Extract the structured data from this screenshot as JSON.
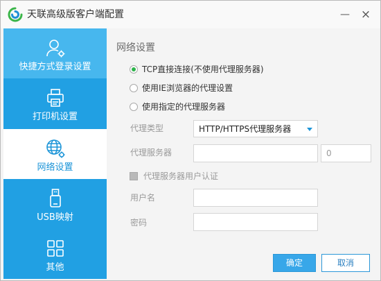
{
  "window": {
    "title": "天联高级版客户端配置",
    "minimize_glyph": "—",
    "close_glyph": "×"
  },
  "sidebar": {
    "items": [
      {
        "label": "快捷方式登录设置",
        "icon": "user-gear-icon",
        "selected": false,
        "highlighted": true
      },
      {
        "label": "打印机设置",
        "icon": "printer-icon",
        "selected": false,
        "highlighted": false
      },
      {
        "label": "网络设置",
        "icon": "globe-gear-icon",
        "selected": true,
        "highlighted": false
      },
      {
        "label": "USB映射",
        "icon": "usb-icon",
        "selected": false,
        "highlighted": false
      },
      {
        "label": "其他",
        "icon": "grid-icon",
        "selected": false,
        "highlighted": false
      }
    ]
  },
  "network": {
    "heading": "网络设置",
    "connection_options": [
      {
        "label": "TCP直接连接(不使用代理服务器)",
        "checked": true
      },
      {
        "label": "使用IE浏览器的代理设置",
        "checked": false
      },
      {
        "label": "使用指定的代理服务器",
        "checked": false
      }
    ],
    "proxy_type": {
      "label": "代理类型",
      "value": "HTTP/HTTPS代理服务器"
    },
    "proxy_server": {
      "label": "代理服务器",
      "value": "",
      "port": "0"
    },
    "auth": {
      "label": "代理服务器用户认证",
      "checked": false
    },
    "username": {
      "label": "用户名",
      "value": ""
    },
    "password": {
      "label": "密码",
      "value": ""
    }
  },
  "buttons": {
    "ok": "确定",
    "cancel": "取消"
  },
  "colors": {
    "sidebar": "#21a0e3",
    "sidebar_hover": "#47b7ee",
    "accent": "#1d95d8",
    "radio_checked": "#2db34b"
  }
}
